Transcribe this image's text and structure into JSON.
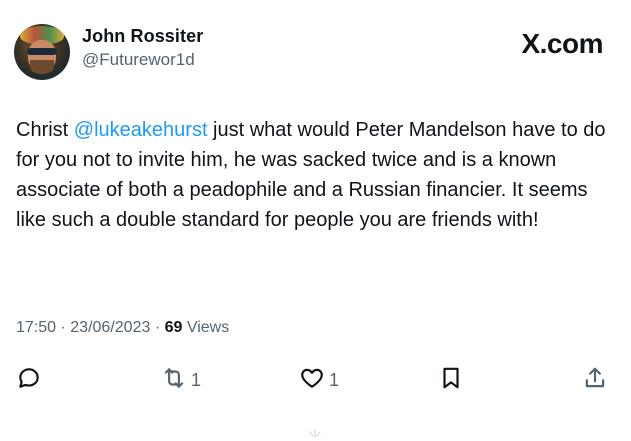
{
  "author": {
    "name": "John Rossiter",
    "handle": "@Futurewor1d"
  },
  "brand": "X.com",
  "tweet": {
    "text_before": "Christ ",
    "mention": "@lukeakehurst",
    "text_after": " just what would Peter Mandelson have to do for you not to invite him, he was sacked twice and is a known associate of both a peadophile and a Russian financier. It seems like such a double standard for people you are friends with!"
  },
  "meta": {
    "time": "17:50",
    "separator": "·",
    "date": "23/06/2023",
    "views_count": "69",
    "views_label": "Views"
  },
  "actions": {
    "reply_icon": "reply-icon",
    "retweet_icon": "retweet-icon",
    "retweet_count": "1",
    "like_icon": "heart-icon",
    "like_count": "1",
    "bookmark_icon": "bookmark-icon",
    "share_icon": "share-icon"
  },
  "colors": {
    "text": "#0f1419",
    "muted": "#536471",
    "mention": "#1d9bf0"
  }
}
